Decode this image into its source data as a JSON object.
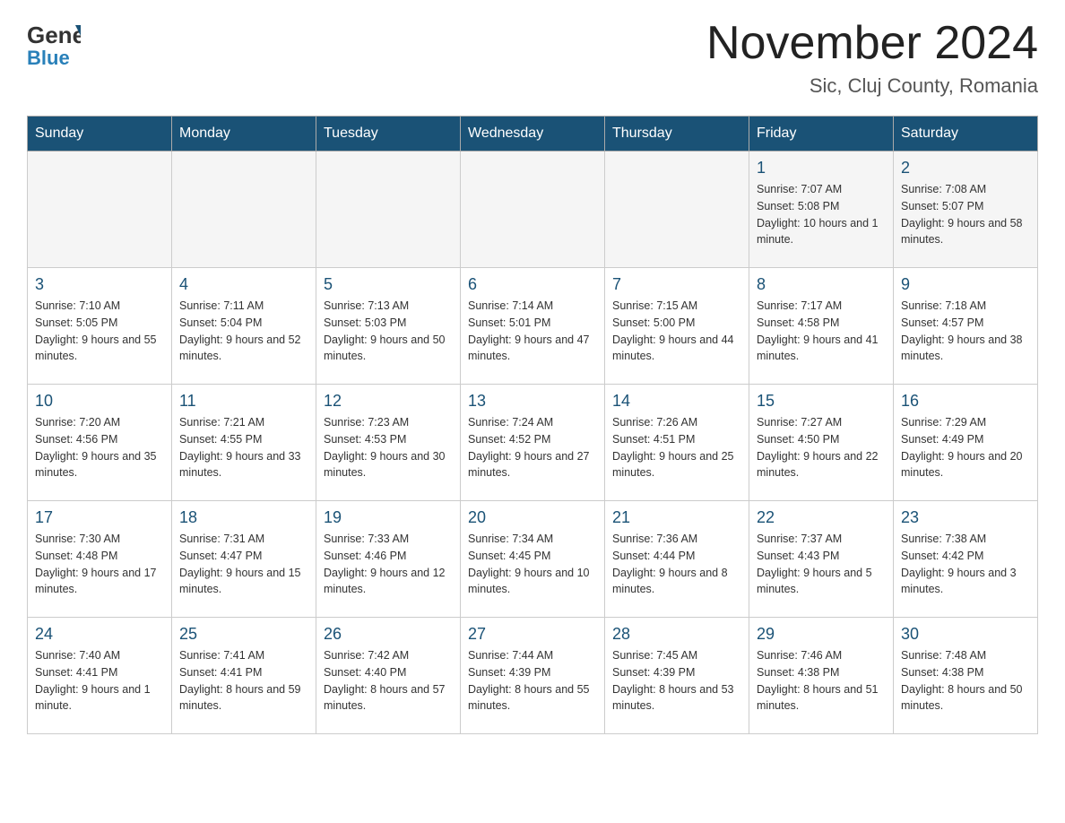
{
  "header": {
    "logo_general": "General",
    "logo_blue": "Blue",
    "month_year": "November 2024",
    "location": "Sic, Cluj County, Romania"
  },
  "days_of_week": [
    "Sunday",
    "Monday",
    "Tuesday",
    "Wednesday",
    "Thursday",
    "Friday",
    "Saturday"
  ],
  "weeks": [
    [
      {
        "day": "",
        "info": ""
      },
      {
        "day": "",
        "info": ""
      },
      {
        "day": "",
        "info": ""
      },
      {
        "day": "",
        "info": ""
      },
      {
        "day": "",
        "info": ""
      },
      {
        "day": "1",
        "info": "Sunrise: 7:07 AM\nSunset: 5:08 PM\nDaylight: 10 hours and 1 minute."
      },
      {
        "day": "2",
        "info": "Sunrise: 7:08 AM\nSunset: 5:07 PM\nDaylight: 9 hours and 58 minutes."
      }
    ],
    [
      {
        "day": "3",
        "info": "Sunrise: 7:10 AM\nSunset: 5:05 PM\nDaylight: 9 hours and 55 minutes."
      },
      {
        "day": "4",
        "info": "Sunrise: 7:11 AM\nSunset: 5:04 PM\nDaylight: 9 hours and 52 minutes."
      },
      {
        "day": "5",
        "info": "Sunrise: 7:13 AM\nSunset: 5:03 PM\nDaylight: 9 hours and 50 minutes."
      },
      {
        "day": "6",
        "info": "Sunrise: 7:14 AM\nSunset: 5:01 PM\nDaylight: 9 hours and 47 minutes."
      },
      {
        "day": "7",
        "info": "Sunrise: 7:15 AM\nSunset: 5:00 PM\nDaylight: 9 hours and 44 minutes."
      },
      {
        "day": "8",
        "info": "Sunrise: 7:17 AM\nSunset: 4:58 PM\nDaylight: 9 hours and 41 minutes."
      },
      {
        "day": "9",
        "info": "Sunrise: 7:18 AM\nSunset: 4:57 PM\nDaylight: 9 hours and 38 minutes."
      }
    ],
    [
      {
        "day": "10",
        "info": "Sunrise: 7:20 AM\nSunset: 4:56 PM\nDaylight: 9 hours and 35 minutes."
      },
      {
        "day": "11",
        "info": "Sunrise: 7:21 AM\nSunset: 4:55 PM\nDaylight: 9 hours and 33 minutes."
      },
      {
        "day": "12",
        "info": "Sunrise: 7:23 AM\nSunset: 4:53 PM\nDaylight: 9 hours and 30 minutes."
      },
      {
        "day": "13",
        "info": "Sunrise: 7:24 AM\nSunset: 4:52 PM\nDaylight: 9 hours and 27 minutes."
      },
      {
        "day": "14",
        "info": "Sunrise: 7:26 AM\nSunset: 4:51 PM\nDaylight: 9 hours and 25 minutes."
      },
      {
        "day": "15",
        "info": "Sunrise: 7:27 AM\nSunset: 4:50 PM\nDaylight: 9 hours and 22 minutes."
      },
      {
        "day": "16",
        "info": "Sunrise: 7:29 AM\nSunset: 4:49 PM\nDaylight: 9 hours and 20 minutes."
      }
    ],
    [
      {
        "day": "17",
        "info": "Sunrise: 7:30 AM\nSunset: 4:48 PM\nDaylight: 9 hours and 17 minutes."
      },
      {
        "day": "18",
        "info": "Sunrise: 7:31 AM\nSunset: 4:47 PM\nDaylight: 9 hours and 15 minutes."
      },
      {
        "day": "19",
        "info": "Sunrise: 7:33 AM\nSunset: 4:46 PM\nDaylight: 9 hours and 12 minutes."
      },
      {
        "day": "20",
        "info": "Sunrise: 7:34 AM\nSunset: 4:45 PM\nDaylight: 9 hours and 10 minutes."
      },
      {
        "day": "21",
        "info": "Sunrise: 7:36 AM\nSunset: 4:44 PM\nDaylight: 9 hours and 8 minutes."
      },
      {
        "day": "22",
        "info": "Sunrise: 7:37 AM\nSunset: 4:43 PM\nDaylight: 9 hours and 5 minutes."
      },
      {
        "day": "23",
        "info": "Sunrise: 7:38 AM\nSunset: 4:42 PM\nDaylight: 9 hours and 3 minutes."
      }
    ],
    [
      {
        "day": "24",
        "info": "Sunrise: 7:40 AM\nSunset: 4:41 PM\nDaylight: 9 hours and 1 minute."
      },
      {
        "day": "25",
        "info": "Sunrise: 7:41 AM\nSunset: 4:41 PM\nDaylight: 8 hours and 59 minutes."
      },
      {
        "day": "26",
        "info": "Sunrise: 7:42 AM\nSunset: 4:40 PM\nDaylight: 8 hours and 57 minutes."
      },
      {
        "day": "27",
        "info": "Sunrise: 7:44 AM\nSunset: 4:39 PM\nDaylight: 8 hours and 55 minutes."
      },
      {
        "day": "28",
        "info": "Sunrise: 7:45 AM\nSunset: 4:39 PM\nDaylight: 8 hours and 53 minutes."
      },
      {
        "day": "29",
        "info": "Sunrise: 7:46 AM\nSunset: 4:38 PM\nDaylight: 8 hours and 51 minutes."
      },
      {
        "day": "30",
        "info": "Sunrise: 7:48 AM\nSunset: 4:38 PM\nDaylight: 8 hours and 50 minutes."
      }
    ]
  ]
}
